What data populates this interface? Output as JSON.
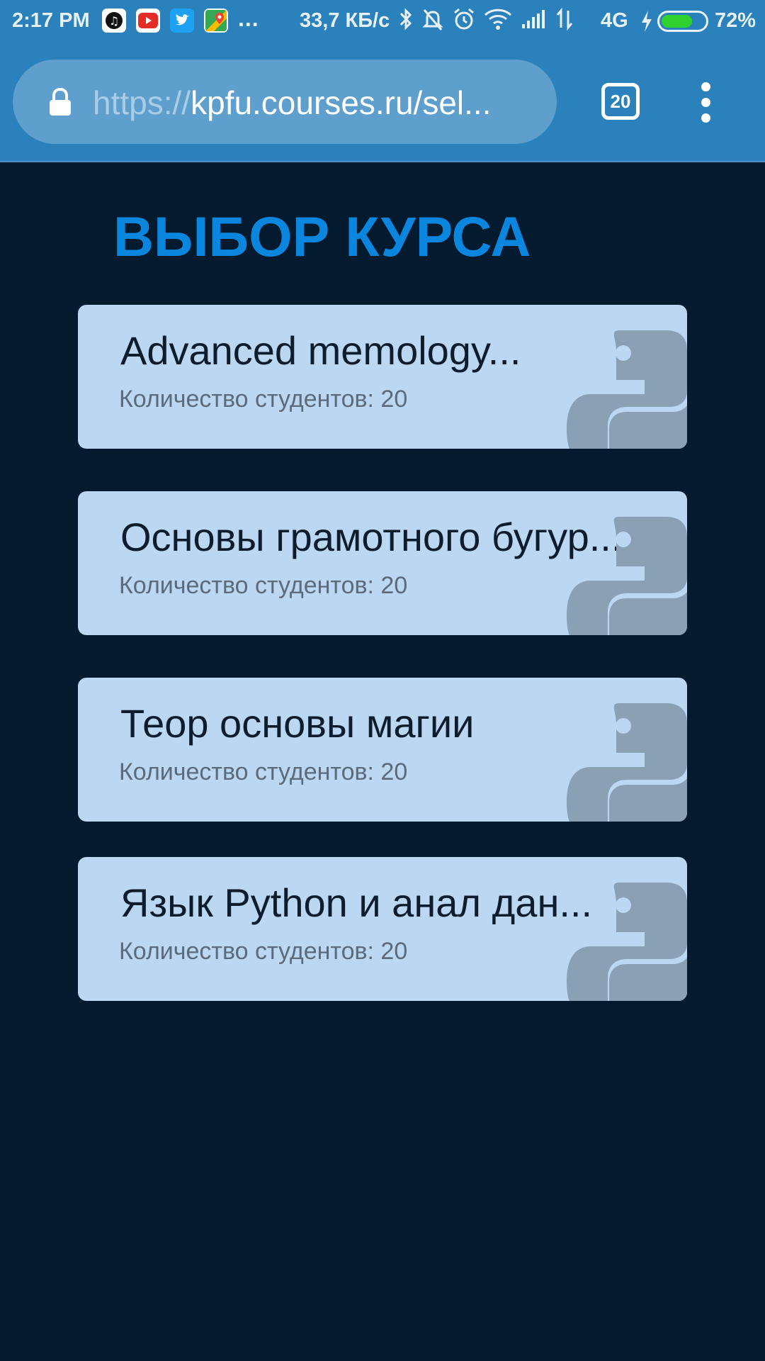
{
  "statusbar": {
    "time": "2:17 PM",
    "dots": "...",
    "speed": "33,7 КБ/с",
    "network": "4G",
    "battery_pct": "72%",
    "battery_level": 0.72,
    "app_icons": [
      "music-app-icon",
      "youtube-icon",
      "twitter-icon",
      "maps-icon"
    ],
    "system_icons": [
      "bluetooth-icon",
      "bell-off-icon",
      "alarm-icon",
      "wifi-icon",
      "signal-icon",
      "data-arrows-icon"
    ]
  },
  "browser": {
    "url_scheme": "https://",
    "url_rest": "kpfu.courses.ru/sel...",
    "tab_count": "20"
  },
  "page": {
    "title": "ВЫБОР КУРСА",
    "courses": [
      {
        "title": "Advanced memology...",
        "students": "Количество студентов: 20"
      },
      {
        "title": "Основы грамотного бугур...",
        "students": "Количество студентов: 20"
      },
      {
        "title": "Теор основы магии",
        "students": "Количество студентов: 20"
      },
      {
        "title": "Язык Python и анал дан...",
        "students": "Количество студентов: 20"
      }
    ]
  },
  "colors": {
    "background": "#041b2f",
    "bar": "#2a81bb",
    "title": "#0b86de",
    "card": "#bcd7f1"
  }
}
